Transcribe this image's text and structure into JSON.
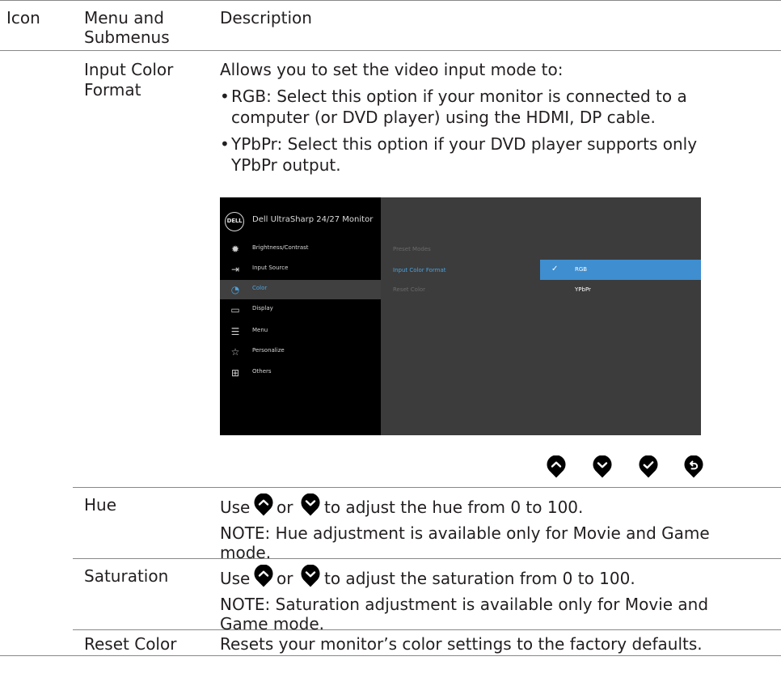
{
  "header": {
    "col_icon": "Icon",
    "col_menu_line1": "Menu and",
    "col_menu_line2": "Submenus",
    "col_desc": "Description"
  },
  "input_color_format": {
    "label_line1": "Input Color",
    "label_line2": "Format",
    "intro": "Allows you to set the video input mode to:",
    "bullet_char": "•",
    "bullet1_line1": "RGB: Select this option if your monitor is connected to a",
    "bullet1_line2": "computer (or DVD player) using the HDMI, DP cable.",
    "bullet2_line1": "YPbPr: Select this option if your DVD player supports only",
    "bullet2_line2": "YPbPr output."
  },
  "osd": {
    "logo": "DELL",
    "title": "Dell UltraSharp 24/27 Monitor",
    "menu": [
      {
        "label": "Brightness/Contrast",
        "icon": "sun-icon"
      },
      {
        "label": "Input Source",
        "icon": "input-source-icon"
      },
      {
        "label": "Color",
        "icon": "palette-icon"
      },
      {
        "label": "Display",
        "icon": "display-icon"
      },
      {
        "label": "Menu",
        "icon": "menu-list-icon"
      },
      {
        "label": "Personalize",
        "icon": "star-icon"
      },
      {
        "label": "Others",
        "icon": "others-icon"
      }
    ],
    "active_menu": "Color",
    "submenu": [
      "Preset Modes",
      "Input Color Format",
      "Reset Color"
    ],
    "active_submenu": "Input Color Format",
    "options": [
      "RGB",
      "YPbPr"
    ],
    "selected_option": "RGB",
    "check_glyph": "✓",
    "accent_color": "#3e8ed0"
  },
  "nav_buttons": [
    "up-button",
    "down-button",
    "ok-button",
    "back-button"
  ],
  "hue": {
    "label": "Hue",
    "use": "Use",
    "or": "or",
    "text": "to adjust the hue from 0 to 100.",
    "note_line1": "NOTE: Hue adjustment is available only for Movie and Game",
    "note_line2": "mode."
  },
  "saturation": {
    "label": "Saturation",
    "use": "Use",
    "or": "or",
    "text": "to adjust the saturation from 0 to 100.",
    "note_line1": "NOTE: Saturation adjustment is available only for Movie and",
    "note_line2": "Game mode."
  },
  "reset_color": {
    "label": "Reset Color",
    "text": "Resets your monitor’s color settings to the factory defaults."
  }
}
